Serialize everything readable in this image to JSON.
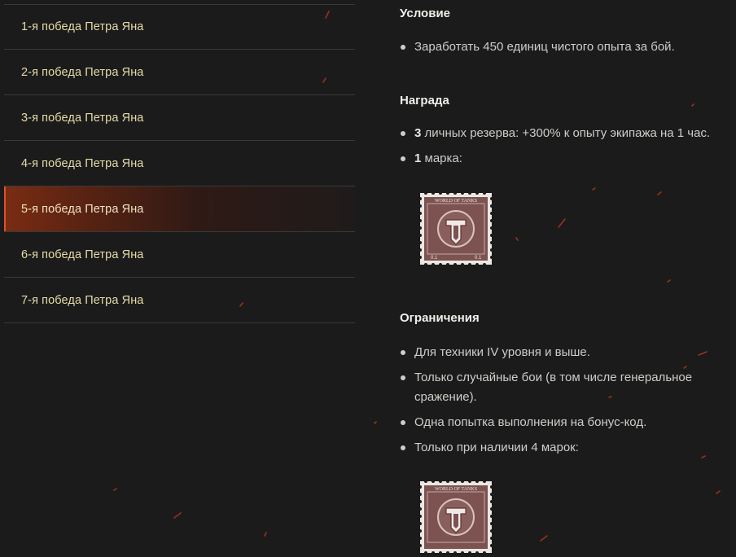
{
  "sidebar": {
    "items": [
      {
        "label": "1-я победа Петра Яна"
      },
      {
        "label": "2-я победа Петра Яна"
      },
      {
        "label": "3-я победа Петра Яна"
      },
      {
        "label": "4-я победа Петра Яна"
      },
      {
        "label": "5-я победа Петра Яна",
        "active": true
      },
      {
        "label": "6-я победа Петра Яна"
      },
      {
        "label": "7-я победа Петра Яна"
      }
    ]
  },
  "condition": {
    "title": "Условие",
    "items": [
      "Заработать 450 единиц чистого опыта за бой."
    ]
  },
  "reward": {
    "title": "Награда",
    "items": [
      {
        "bold": "3",
        "text": " личных резерва: +300% к опыту экипажа на 1 час."
      },
      {
        "bold": "1",
        "text": " марка:"
      }
    ],
    "stamp_text": "WORLD OF TANKS"
  },
  "restrictions": {
    "title": "Ограничения",
    "items": [
      "Для техники IV уровня и выше.",
      "Только случайные бои (в том числе генеральное сражение).",
      "Одна попытка выполнения на бонус-код.",
      "Только при наличии 4 марок:"
    ],
    "stamp_text": "WORLD OF TANKS"
  },
  "colors": {
    "background": "#1b1b1c",
    "accent": "#e0502a",
    "sidebar_text": "#e6dca6",
    "stamp": "#7c5350"
  }
}
